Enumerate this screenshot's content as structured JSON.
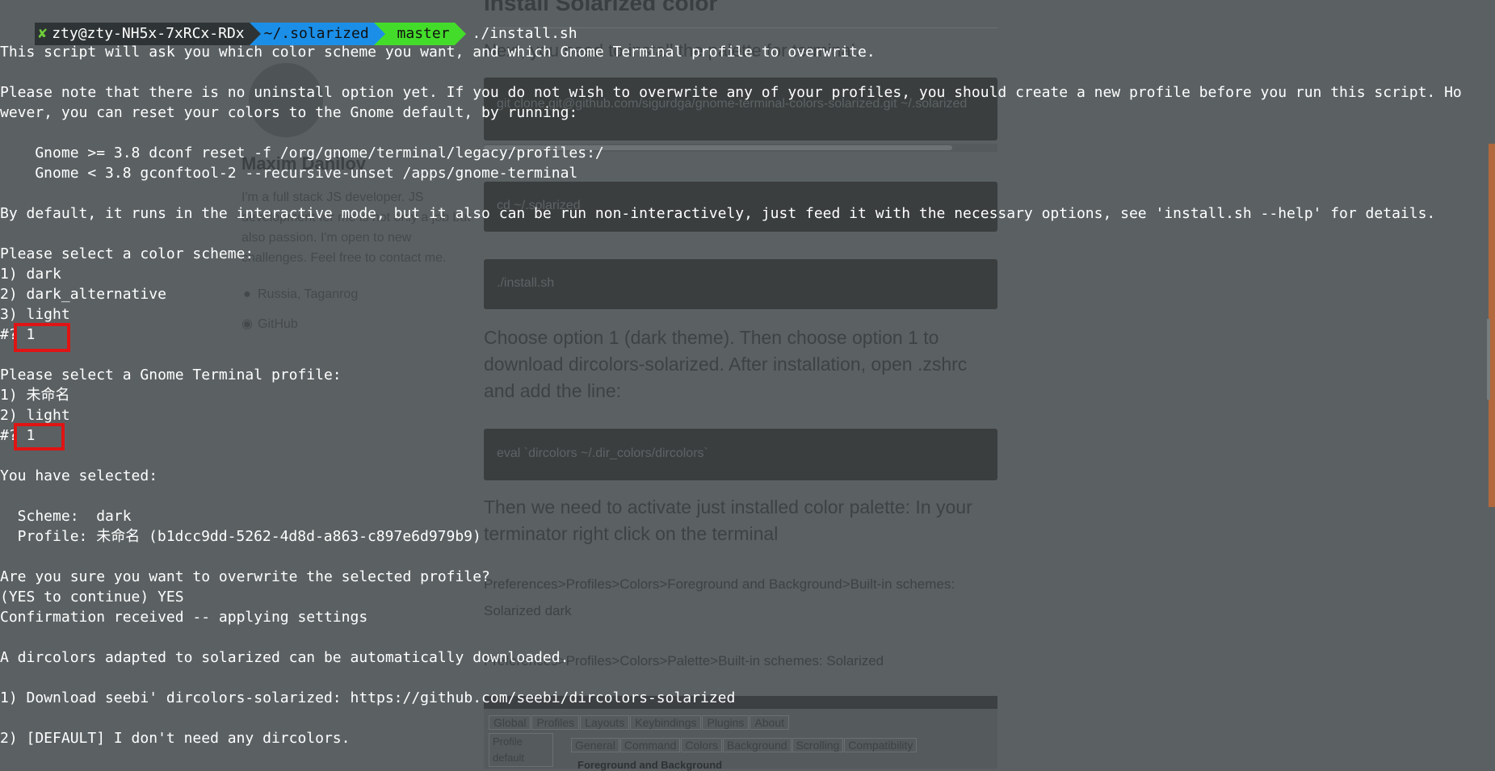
{
  "prompt": {
    "status_icon": "✘",
    "user_host": "zty@zty-NH5x-7xRCx-RDx",
    "directory": "~/.solarized",
    "branch_icon": "",
    "branch": "master",
    "command": "./install.sh"
  },
  "terminal_lines": [
    "This script will ask you which color scheme you want, and which Gnome Terminal profile to overwrite.",
    "",
    "Please note that there is no uninstall option yet. If you do not wish to overwrite any of your profiles, you should create a new profile before you run this script. Ho",
    "wever, you can reset your colors to the Gnome default, by running:",
    "",
    "    Gnome >= 3.8 dconf reset -f /org/gnome/terminal/legacy/profiles:/",
    "    Gnome < 3.8 gconftool-2 --recursive-unset /apps/gnome-terminal",
    "",
    "By default, it runs in the interactive mode, but it also can be run non-interactively, just feed it with the necessary options, see 'install.sh --help' for details.",
    "",
    "Please select a color scheme:",
    "1) dark",
    "2) dark_alternative",
    "3) light",
    "#? 1",
    "",
    "Please select a Gnome Terminal profile:",
    "1) 未命名",
    "2) light",
    "#? 1",
    "",
    "You have selected:",
    "",
    "  Scheme:  dark",
    "  Profile: 未命名 (b1dcc9dd-5262-4d8d-a863-c897e6d979b9)",
    "",
    "Are you sure you want to overwrite the selected profile?",
    "(YES to continue) YES",
    "Confirmation received -- applying settings",
    "",
    "A dircolors adapted to solarized can be automatically downloaded.",
    "",
    "1) Download seebi' dircolors-solarized: https://github.com/seebi/dircolors-solarized",
    "",
    "2) [DEFAULT] I don't need any dircolors."
  ],
  "background_page": {
    "heading": "Install Solarized color",
    "intro": "Next, you need to install the palette for terminal.",
    "code_blocks": [
      "git clone git@github.com/sigurdga/gnome-terminal-colors-solarized.git ~/.solarized",
      "cd ~/.solarized",
      "./install.sh",
      "eval `dircolors ~/.dir_colors/dircolors`"
    ],
    "para_option": "Choose option 1 (dark theme). Then choose option 1 to download dircolors-solarized. After installation, open .zshrc and add the line:",
    "para_activate": "Then we need to activate just installed color palette: In your terminator right click on the terminal",
    "path_fg_bg": "Preferences>Profiles>Colors>Foreground and Background>Built-in schemes: Solarized dark",
    "path_palette": "Preferences>Profiles>Colors>Palette>Built-in schemes: Solarized",
    "author_name": "Maxim Danilov",
    "author_bio": "I'm a full stack JS developer. JS development for me is not only a job but also passion. I'm open to new challenges. Feel free to contact me.",
    "location": "Russia, Taganrog",
    "github": "GitHub",
    "dialog_tabs": [
      "Global",
      "Profiles",
      "Layouts",
      "Keybindings",
      "Plugins",
      "About"
    ],
    "dialog_profiles": [
      "Profile",
      "default"
    ],
    "dialog_subtabs": [
      "General",
      "Command",
      "Colors",
      "Background",
      "Scrolling",
      "Compatibility"
    ],
    "dialog_section": "Foreground and Background"
  },
  "colors": {
    "terminal_text": "#ffffff",
    "highlight_box": "#e01414",
    "prompt_dir_bg": "#1b8fe8",
    "prompt_git_bg": "#44dc2a"
  }
}
